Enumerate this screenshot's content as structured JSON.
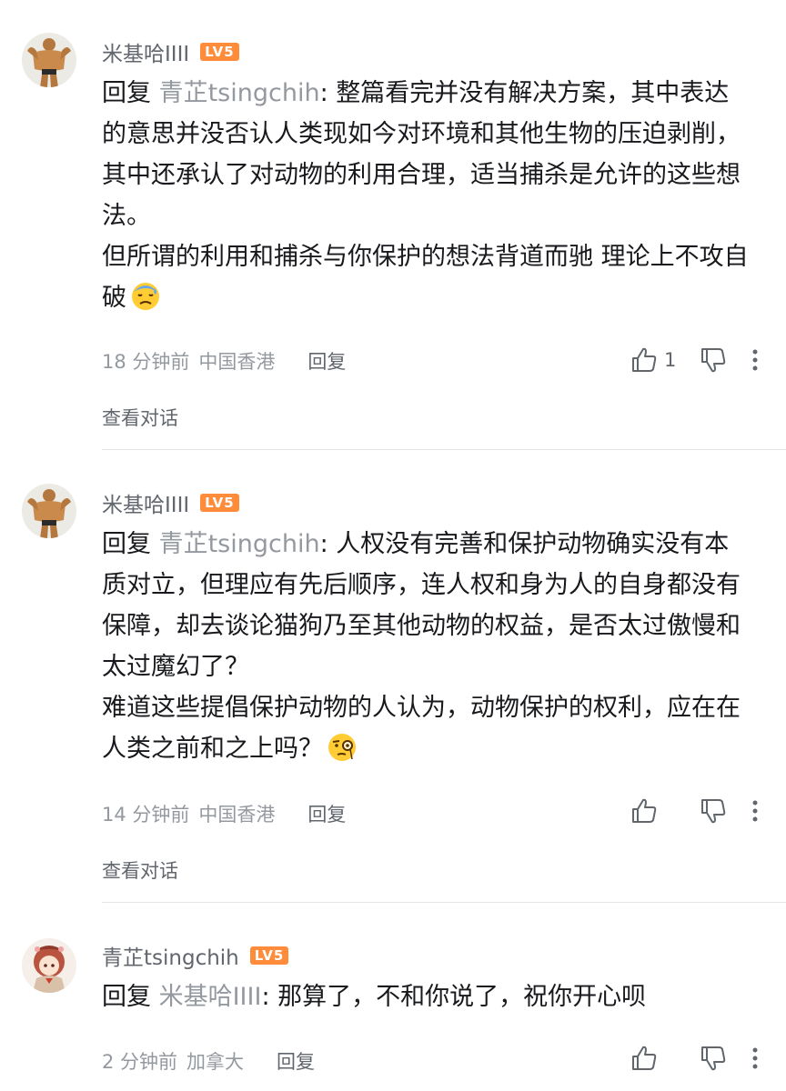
{
  "comments": [
    {
      "username": "米基哈IIII",
      "level": "LV5",
      "reply_prefix": "回复",
      "reply_target": "青芷tsingchih",
      "paragraphs": [
        ": 整篇看完并没有解决方案，其中表达的意思并没否认人类现如今对环境和其他生物的压迫剥削，其中还承认了对动物的利用合理，适当捕杀是允许的这些想法。",
        "但所谓的利用和捕杀与你保护的想法背道而驰  理论上不攻自破"
      ],
      "emoji": "sweat-face-emoji",
      "time": "18 分钟前",
      "location": "中国香港",
      "reply_label": "回复",
      "like_count": "1",
      "view_conversation": "查看对话"
    },
    {
      "username": "米基哈IIII",
      "level": "LV5",
      "reply_prefix": "回复",
      "reply_target": "青芷tsingchih",
      "paragraphs": [
        ": 人权没有完善和保护动物确实没有本质对立，但理应有先后顺序，连人权和身为人的自身都没有保障，却去谈论猫狗乃至其他动物的权益，是否太过傲慢和太过魔幻了？",
        "难道这些提倡保护动物的人认为，动物保护的权利，应在在人类之前和之上吗？"
      ],
      "emoji": "monocle-face-emoji",
      "time": "14 分钟前",
      "location": "中国香港",
      "reply_label": "回复",
      "like_count": "",
      "view_conversation": "查看对话"
    },
    {
      "username": "青芷tsingchih",
      "level": "LV5",
      "reply_prefix": "回复",
      "reply_target": "米基哈IIII",
      "paragraphs": [
        ": 那算了，不和你说了，祝你开心呗"
      ],
      "time": "2 分钟前",
      "location": "加拿大",
      "reply_label": "回复",
      "like_count": ""
    }
  ],
  "colors": {
    "level_badge": "#ff8c3a",
    "muted_text": "#9499a0",
    "body_text": "#18191c"
  }
}
